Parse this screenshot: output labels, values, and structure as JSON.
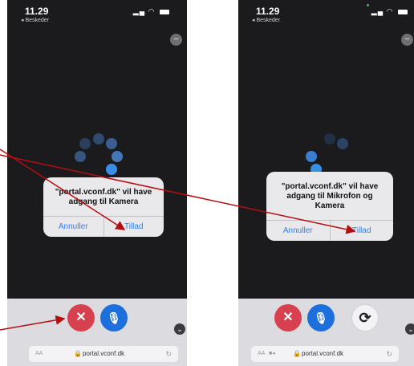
{
  "left": {
    "time": "11.29",
    "back": "◂ Beskeder",
    "minimize": "–",
    "dialog": {
      "line1": "\"portal.vconf.dk\" vil have",
      "line2": "adgang til Kamera",
      "cancel": "Annuller",
      "allow": "Tillad"
    },
    "end_icon": "✕",
    "mic_icon": "🎙",
    "chevron": "⌄",
    "url": "portal.vconf.dk",
    "aa": "AA"
  },
  "right": {
    "time": "11.29",
    "back": "◂ Beskeder",
    "minimize": "–",
    "dialog": {
      "line1": "\"portal.vconf.dk\" vil have",
      "line2": "adgang til Mikrofon og",
      "line3": "Kamera",
      "cancel": "Annuller",
      "allow": "Tillad"
    },
    "end_icon": "✕",
    "mic_icon": "🎙",
    "flip_icon": "⟳",
    "chevron": "⌄",
    "url": "portal.vconf.dk",
    "aa": "AA"
  },
  "colors": {
    "end_call": "#d7414f",
    "mic": "#1d6fdc",
    "dialog_button": "#2f7ef6",
    "arrow": "#b50e12",
    "spinner": "#3a8ee8"
  }
}
